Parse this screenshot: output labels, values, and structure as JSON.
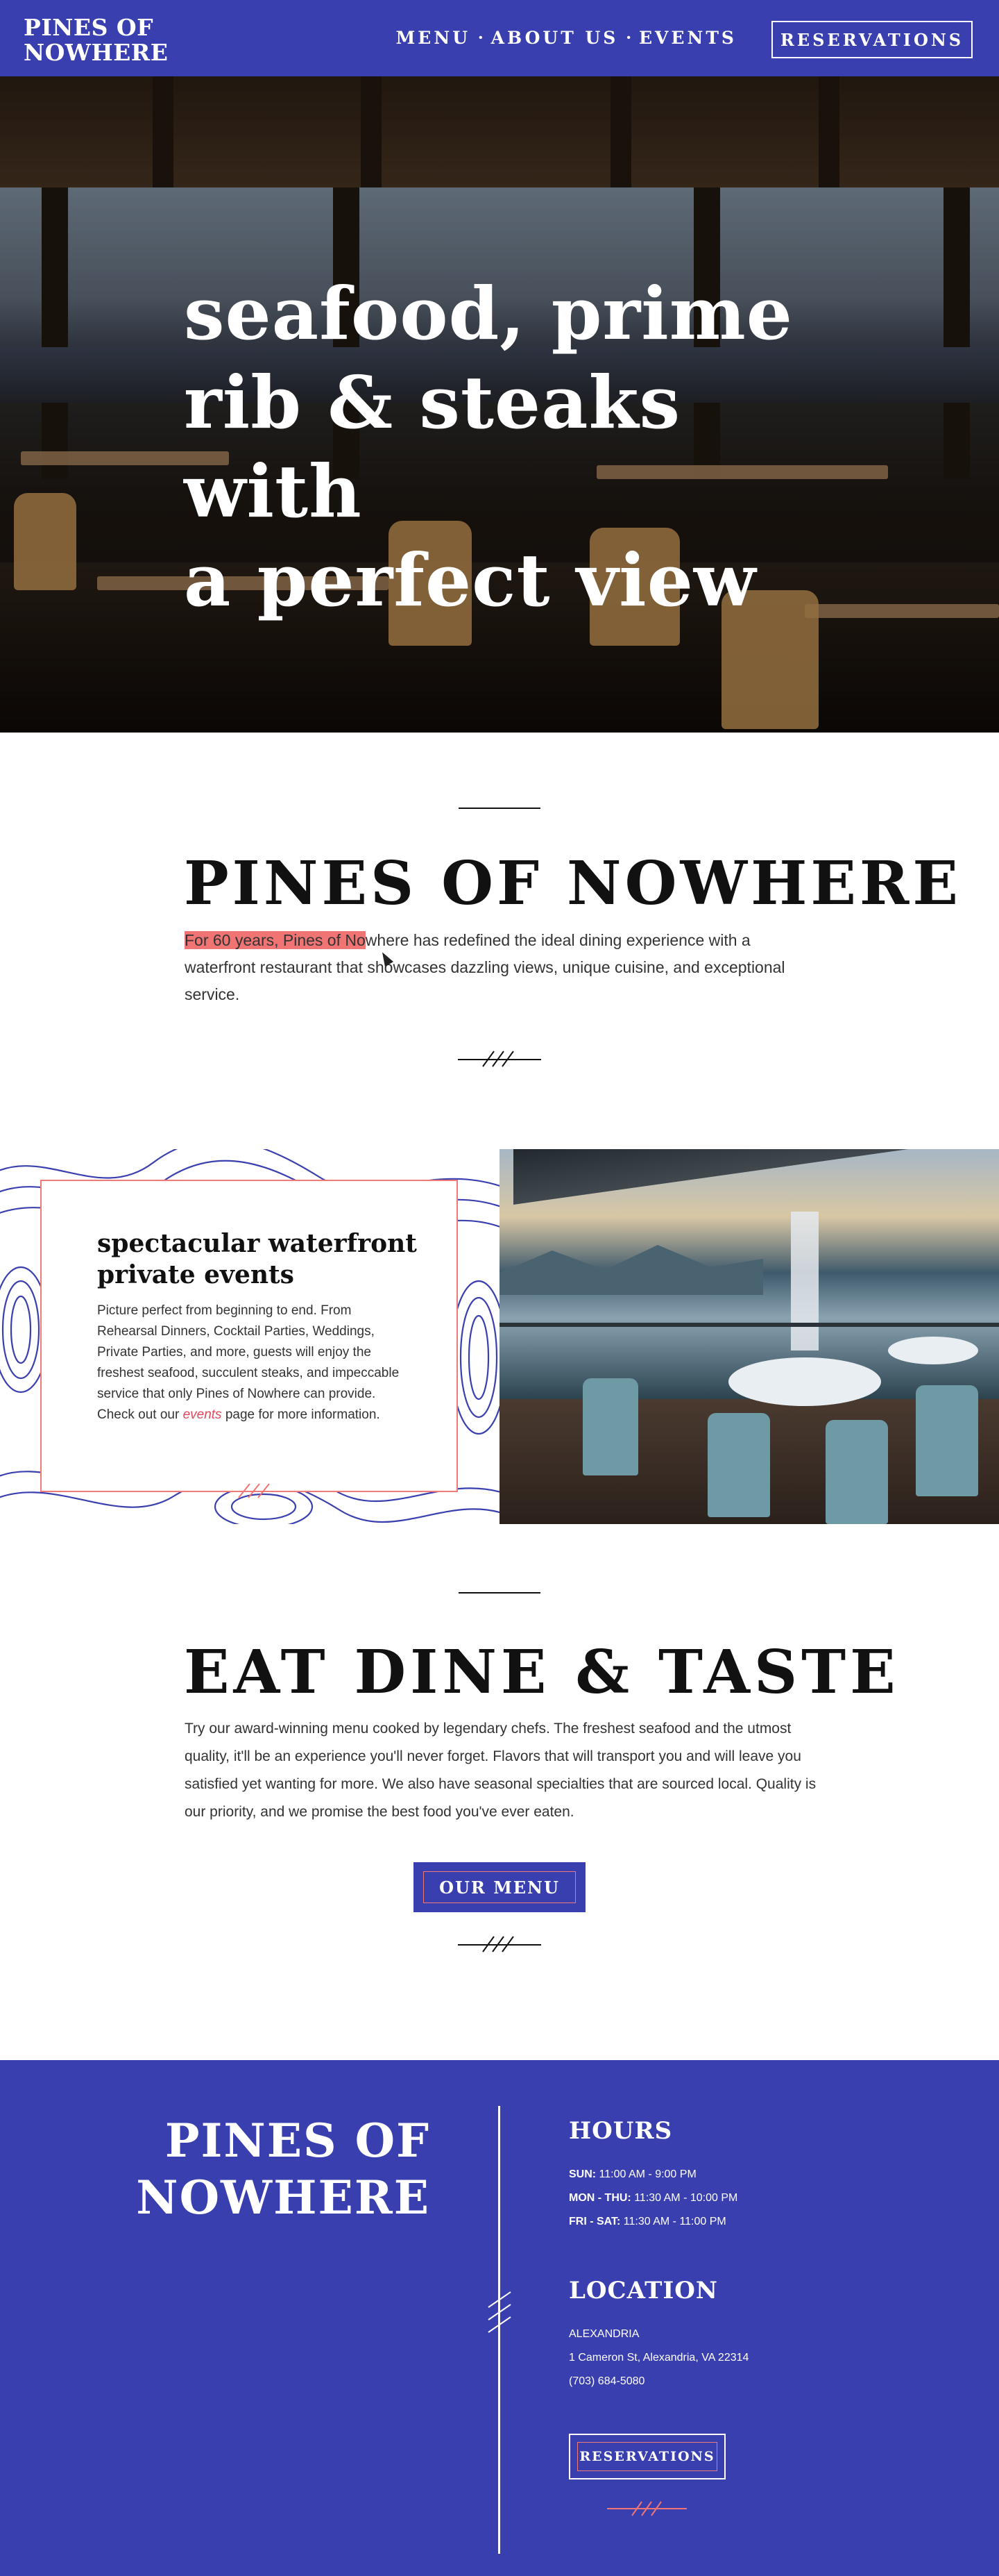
{
  "header": {
    "logo": [
      "PINES OF",
      "NOWHERE"
    ],
    "nav": [
      {
        "label": "MENU"
      },
      {
        "label": "ABOUT US"
      },
      {
        "label": "EVENTS"
      }
    ],
    "nav_separator": "•",
    "reservations": "RESERVATIONS"
  },
  "hero": {
    "headline_lines": [
      "seafood, prime",
      "rib & steaks with",
      "a perfect view"
    ]
  },
  "about": {
    "title": "PINES OF NOWHERE",
    "text_highlighted": "For 60 years, Pines of No",
    "text_rest": "where has redefined the ideal dining experience with a waterfront restaurant that showcases dazzling views, unique cuisine, and exceptional service."
  },
  "events": {
    "title": "spectacular waterfront private events",
    "text_before": "Picture perfect from beginning to end. From Rehearsal Dinners, Cocktail Parties, Weddings, Private Parties, and more, guests will enjoy the freshest seafood, succulent steaks, and impeccable service that only Pines of Nowhere can provide. Check out our ",
    "link": "events",
    "text_after": " page for more information."
  },
  "eat": {
    "title": "EAT DINE & TASTE",
    "text": "Try our award-winning menu cooked by legendary chefs. The freshest seafood and the utmost quality, it'll be an experience you'll never forget. Flavors that will transport you and will leave you satisfied yet wanting for more. We also have seasonal specialties that are sourced local. Quality is our priority, and we promise the best food you've ever eaten.",
    "button": "OUR MENU"
  },
  "footer": {
    "logo": [
      "PINES OF",
      "NOWHERE"
    ],
    "hours_title": "HOURS",
    "hours": [
      {
        "days": "SUN:",
        "time": " 11:00 AM - 9:00 PM"
      },
      {
        "days": "MON - THU:",
        "time": " 11:30 AM - 10:00 PM"
      },
      {
        "days": "FRI - SAT:",
        "time": " 11:30 AM - 11:00 PM"
      }
    ],
    "location_title": "LOCATION",
    "location_lines": [
      "ALEXANDRIA",
      "1 Cameron St, Alexandria, VA 22314",
      "(703) 684-5080"
    ],
    "button": "RESERVATIONS"
  },
  "colors": {
    "brand": "#3a3fb0",
    "accent": "#f07474",
    "link": "#e2485c"
  },
  "icons": [
    "cursor-icon",
    "triple-slash-icon"
  ]
}
